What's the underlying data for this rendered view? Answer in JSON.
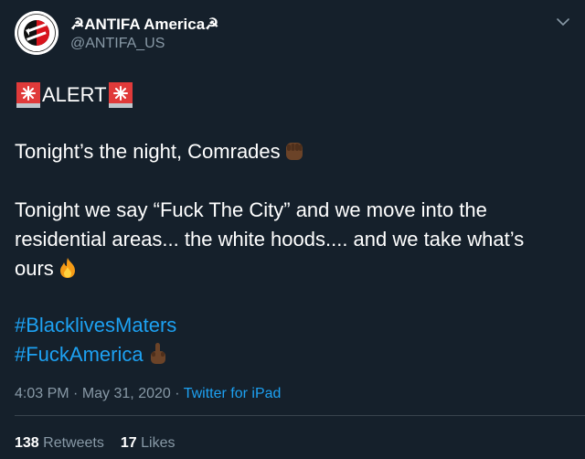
{
  "account": {
    "display_name": "☭ANTIFA America☭",
    "handle": "@ANTIFA_US"
  },
  "tweet": {
    "alert_text": "ALERT",
    "line_1": "Tonight’s the night, Comrades",
    "line_2a": "Tonight we say “Fuck The City” and we move into the",
    "line_2b": "residential areas... the white hoods.... and we take what’s",
    "line_2c": "ours",
    "hashtag_1": "#BlacklivesMaters",
    "hashtag_2": "#FuckAmerica"
  },
  "meta": {
    "time": "4:03 PM",
    "separator_1": "·",
    "date": "May 31, 2020",
    "separator_2": "·",
    "source": "Twitter for iPad"
  },
  "stats": {
    "retweets_count": "138",
    "retweets_label": "Retweets",
    "likes_count": "17",
    "likes_label": "Likes"
  },
  "icons": {
    "siren": "police-light-emoji",
    "fist": "raised-fist-emoji",
    "fire": "fire-emoji",
    "middle_finger": "middle-finger-emoji",
    "chevron": "chevron-down-icon"
  },
  "colors": {
    "background": "#15202b",
    "text": "#ffffff",
    "secondary": "#8899a6",
    "link": "#1da1f2",
    "divider": "#38444d"
  }
}
